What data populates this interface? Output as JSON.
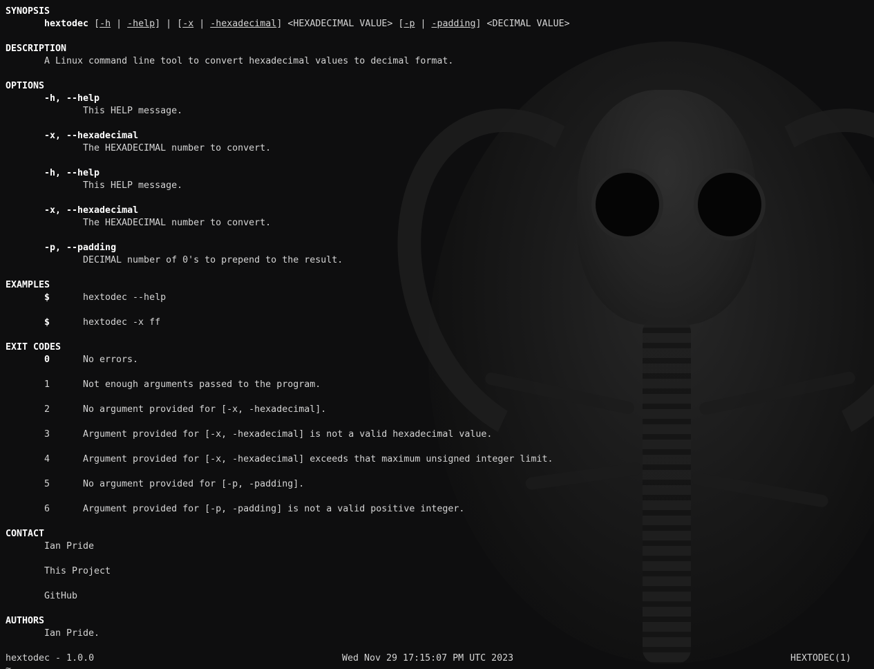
{
  "sections": {
    "synopsis": {
      "header": "SYNOPSIS",
      "cmd": "hextodec",
      "b1": "[",
      "opt_h": "-h",
      "pipe1": " | ",
      "opt_help": "-help",
      "b2": "] | [",
      "opt_x": "-x",
      "pipe2": " | ",
      "opt_hexadecimal": "-hexadecimal",
      "b3": "] <HEXADECIMAL VALUE> [",
      "opt_p": "-p",
      "pipe3": " | ",
      "opt_padding": "-padding",
      "b4": "] <DECIMAL VALUE>"
    },
    "description": {
      "header": "DESCRIPTION",
      "text": "A Linux command line tool to convert hexadecimal values to decimal format."
    },
    "options": {
      "header": "OPTIONS",
      "items": [
        {
          "flag": "-h, --help",
          "desc": "This HELP message."
        },
        {
          "flag": "-x, --hexadecimal",
          "desc": "The HEXADECIMAL number to convert."
        },
        {
          "flag": "-h, --help",
          "desc": "This HELP message."
        },
        {
          "flag": "-x, --hexadecimal",
          "desc": "The HEXADECIMAL number to convert."
        },
        {
          "flag": "-p, --padding",
          "desc": "DECIMAL number of 0's to prepend to the result."
        }
      ]
    },
    "examples": {
      "header": "EXAMPLES",
      "items": [
        {
          "prompt": "$",
          "cmd": "hextodec --help"
        },
        {
          "prompt": "$",
          "cmd": "hextodec -x ff"
        }
      ]
    },
    "exit_codes": {
      "header": "EXIT CODES",
      "items": [
        {
          "code": "0",
          "desc": "No errors."
        },
        {
          "code": "1",
          "desc": "Not enough arguments passed to the program."
        },
        {
          "code": "2",
          "desc": "No argument provided for [-x, -hexadecimal]."
        },
        {
          "code": "3",
          "desc": "Argument provided for [-x, -hexadecimal] is not a valid hexadecimal value."
        },
        {
          "code": "4",
          "desc": "Argument provided for [-x, -hexadecimal] exceeds that maximum unsigned integer limit."
        },
        {
          "code": "5",
          "desc": "No argument provided for [-p, -padding]."
        },
        {
          "code": "6",
          "desc": "Argument provided for [-p, -padding] is not a valid positive integer."
        }
      ]
    },
    "contact": {
      "header": "CONTACT",
      "items": [
        "Ian Pride",
        "This Project",
        "GitHub"
      ]
    },
    "authors": {
      "header": "AUTHORS",
      "text": "Ian Pride."
    }
  },
  "footer": {
    "left": "hextodec - 1.0.0",
    "middle": "Wed Nov 29 17:15:07 PM UTC 2023",
    "right": "HEXTODEC(1)"
  },
  "prompt_char": "~",
  "colors": {
    "background": "#0e0e0f",
    "text": "#d4d4d4",
    "bold_text": "#ffffff"
  }
}
